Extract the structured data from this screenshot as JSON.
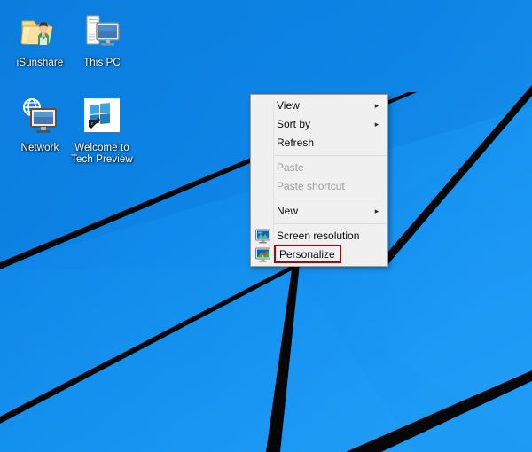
{
  "desktop": {
    "background_color": "#0e87ea",
    "wallpaper_line_color": "#070707",
    "icons": [
      {
        "name": "isunshare",
        "label": "iSunshare",
        "icon": "folder-user-icon"
      },
      {
        "name": "this-pc",
        "label": "This PC",
        "icon": "computer-icon"
      },
      {
        "name": "network",
        "label": "Network",
        "icon": "network-globe-monitor-icon"
      },
      {
        "name": "welcome-tech-preview",
        "label": "Welcome to\nTech Preview",
        "label_line1": "Welcome to",
        "label_line2": "Tech Preview",
        "icon": "windows-logo-shortcut-icon"
      }
    ]
  },
  "context_menu": {
    "background_color": "#f0f0f0",
    "border_color": "#9a9a9a",
    "highlight_color": "#9c0d12",
    "disabled_text_color": "#9d9d9d",
    "items": [
      {
        "key": "view",
        "label": "View",
        "disabled": false,
        "submenu": true,
        "arrow": "▸",
        "icon": null,
        "highlighted": false
      },
      {
        "key": "sort-by",
        "label": "Sort by",
        "disabled": false,
        "submenu": true,
        "arrow": "▸",
        "icon": null,
        "highlighted": false
      },
      {
        "key": "refresh",
        "label": "Refresh",
        "disabled": false,
        "submenu": false,
        "arrow": "",
        "icon": null,
        "highlighted": false
      },
      {
        "key": "paste",
        "label": "Paste",
        "disabled": true,
        "submenu": false,
        "arrow": "",
        "icon": null,
        "highlighted": false
      },
      {
        "key": "paste-shortcut",
        "label": "Paste shortcut",
        "disabled": true,
        "submenu": false,
        "arrow": "",
        "icon": null,
        "highlighted": false
      },
      {
        "key": "new",
        "label": "New",
        "disabled": false,
        "submenu": true,
        "arrow": "▸",
        "icon": null,
        "highlighted": false
      },
      {
        "key": "screen-resolution",
        "label": "Screen resolution",
        "disabled": false,
        "submenu": false,
        "arrow": "",
        "icon": "monitor-blue-icon",
        "highlighted": false
      },
      {
        "key": "personalize",
        "label": "Personalize",
        "disabled": false,
        "submenu": false,
        "arrow": "",
        "icon": "monitor-brush-icon",
        "highlighted": true
      }
    ]
  }
}
